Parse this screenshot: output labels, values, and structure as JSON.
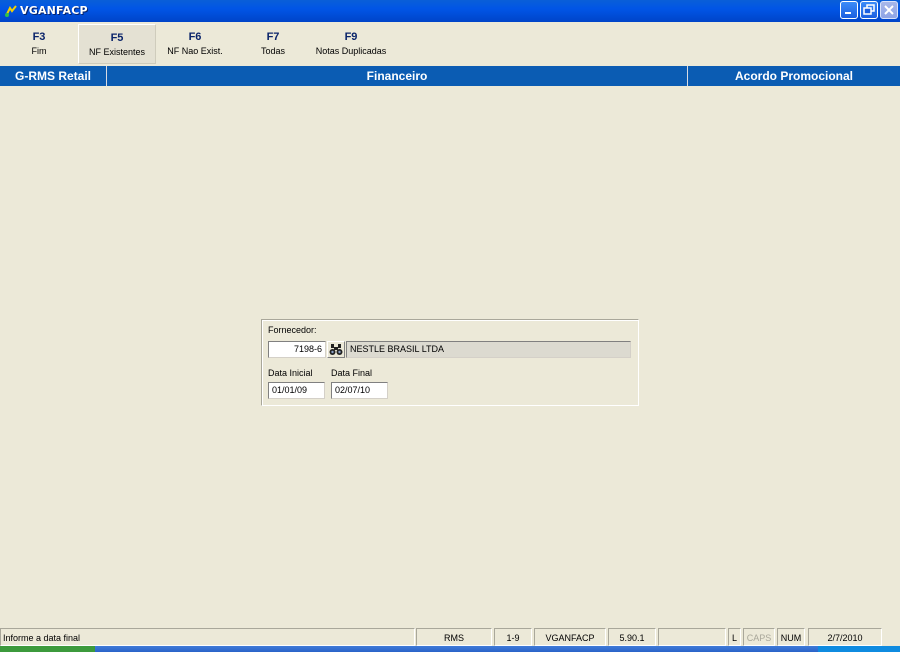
{
  "window": {
    "title": "VGANFACP"
  },
  "toolbar": {
    "buttons": [
      {
        "key": "F3",
        "label": "Fim"
      },
      {
        "key": "F5",
        "label": "NF Existentes"
      },
      {
        "key": "F6",
        "label": "NF Nao Exist."
      },
      {
        "key": "F7",
        "label": "Todas"
      },
      {
        "key": "F9",
        "label": "Notas Duplicadas"
      }
    ]
  },
  "header": {
    "left": "G-RMS Retail",
    "center": "Financeiro",
    "right": "Acordo Promocional"
  },
  "form": {
    "fornecedor_label": "Fornecedor:",
    "fornecedor_code": "7198-6",
    "fornecedor_name": "NESTLE BRASIL LTDA",
    "data_inicial_label": "Data Inicial",
    "data_inicial_value": "01/01/09",
    "data_final_label": "Data Final",
    "data_final_value": "02/07/10",
    "lookup_icon": "binoculars-icon"
  },
  "statusbar": {
    "message": "Informe a data final",
    "system": "RMS",
    "range": "1-9",
    "program": "VGANFACP",
    "version": "5.90.1",
    "blank": "",
    "l_indicator": "L",
    "caps": "CAPS",
    "num": "NUM",
    "date": "2/7/2010"
  },
  "colors": {
    "titlebar": "#0155e6",
    "header_band": "#0b5cb3",
    "background": "#ece9d8",
    "key_text": "#0a246a"
  }
}
